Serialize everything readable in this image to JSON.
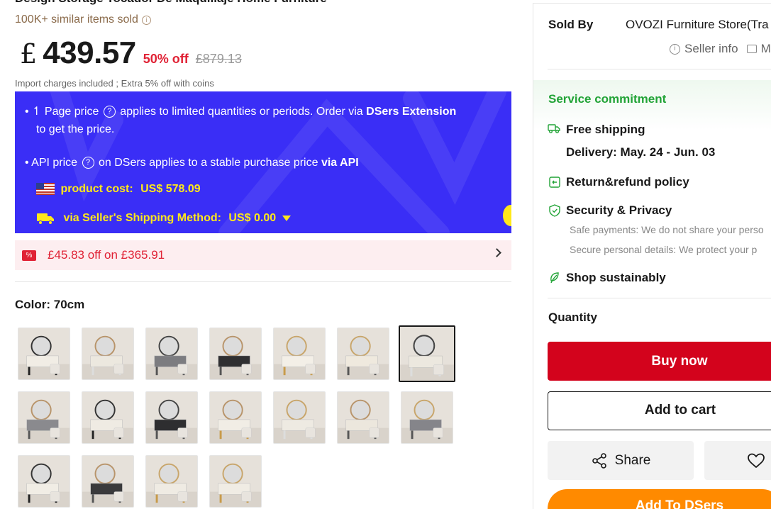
{
  "product": {
    "title_partial": "Design Storage Tocador De Maquillaje Home Furniture",
    "sold_count": "100K+ similar items sold",
    "price_currency": "£",
    "price_value": "439.57",
    "discount": "50% off",
    "original_price": "£879.13",
    "import_note": "Import charges included ; Extra 5% off with coins"
  },
  "dsers": {
    "line1_a": "• ↿ Page price",
    "line1_b": "applies to limited quantities or periods. Order via",
    "line1_bold": "DSers Extension",
    "line1_c": "to get the price.",
    "line2_a": "• API price",
    "line2_b": "on DSers applies to a stable purchase price",
    "line2_bold": "via API",
    "product_cost_label": "product cost:",
    "product_cost_value": "US$ 578.09",
    "shipping_label": "via Seller's Shipping Method:",
    "shipping_value": "US$ 0.00",
    "help_glyph": "?"
  },
  "coupon": {
    "icon_text": "%",
    "text": "£45.83 off on £365.91"
  },
  "color": {
    "label": "Color: 70cm",
    "selected_index": 6,
    "swatch_count": 18
  },
  "seller": {
    "sold_by_label": "Sold By",
    "store_name": "OVOZI Furniture Store(Tra",
    "seller_info": "Seller info",
    "message_cut": "M"
  },
  "service": {
    "title": "Service commitment",
    "free_shipping": "Free shipping",
    "delivery": "Delivery: May. 24 - Jun. 03",
    "return_policy": "Return&refund policy",
    "security": "Security & Privacy",
    "safe_payments": "Safe payments: We do not share your perso",
    "secure_details": "Secure personal details: We protect your p",
    "sustainable": "Shop sustainably"
  },
  "purchase": {
    "quantity_label": "Quantity",
    "buy_now": "Buy now",
    "add_to_cart": "Add to cart",
    "share": "Share",
    "add_to_dsers": "Add To DSers"
  },
  "colors": {
    "accent_red": "#d3031c",
    "dsers_blue": "#3a2ef6",
    "dsers_yellow": "#ffe81a",
    "service_green": "#21a336",
    "dsers_orange": "#ff8a00"
  }
}
